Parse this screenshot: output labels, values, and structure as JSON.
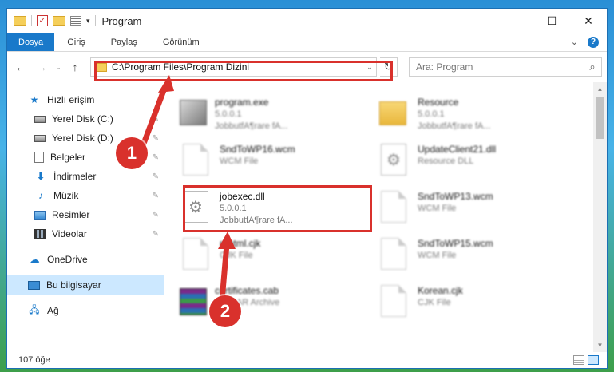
{
  "window": {
    "title": "Program",
    "controls": {
      "minimize": "—",
      "maximize": "☐",
      "close": "✕"
    }
  },
  "ribbon": {
    "tabs": [
      "Dosya",
      "Giriş",
      "Paylaş",
      "Görünüm"
    ],
    "expand": "⌄",
    "help": "?"
  },
  "nav": {
    "back": "←",
    "forward": "→",
    "recent": "⌄",
    "up": "↑",
    "address": "C:\\Program Files\\Program Dizini",
    "address_dropdown": "⌄",
    "refresh": "↻",
    "search_placeholder": "Ara: Program"
  },
  "sidebar": {
    "quick_access": "Hızlı erişim",
    "items": [
      {
        "label": "Yerel Disk (C:)",
        "icon": "disk-icon"
      },
      {
        "label": "Yerel Disk (D:)",
        "icon": "disk-icon"
      },
      {
        "label": "Belgeler",
        "icon": "document-icon"
      },
      {
        "label": "İndirmeler",
        "icon": "download-icon"
      },
      {
        "label": "Müzik",
        "icon": "music-icon"
      },
      {
        "label": "Resimler",
        "icon": "pictures-icon"
      },
      {
        "label": "Videolar",
        "icon": "videos-icon"
      }
    ],
    "onedrive": "OneDrive",
    "this_pc": "Bu bilgisayar",
    "network": "Ağ"
  },
  "files": [
    {
      "name": "program.exe",
      "line2": "5.0.0.1",
      "line3": "JobbutfA¶rare fA...",
      "icon": "exe"
    },
    {
      "name": "Resource",
      "line2": "5.0.0.1",
      "line3": "JobbutfA¶rare fA...",
      "icon": "folder"
    },
    {
      "name": "SndToWP16.wcm",
      "line2": "WCM File",
      "line3": "",
      "icon": "page"
    },
    {
      "name": "UpdateClient21.dll",
      "line2": "Resource DLL",
      "line3": "",
      "icon": "gear"
    },
    {
      "name": "jobexec.dll",
      "line2": "5.0.0.1",
      "line3": "JobbutfA¶rare fA...",
      "icon": "gear"
    },
    {
      "name": "SndToWP13.wcm",
      "line2": "WCM File",
      "line3": "",
      "icon": "page"
    },
    {
      "name": "rtfhtml.cjk",
      "line2": "CJK File",
      "line3": "",
      "icon": "page"
    },
    {
      "name": "SndToWP15.wcm",
      "line2": "WCM File",
      "line3": "",
      "icon": "page"
    },
    {
      "name": "certificates.cab",
      "line2": "WinRAR Archive",
      "line3": "",
      "icon": "cab"
    },
    {
      "name": "Korean.cjk",
      "line2": "CJK File",
      "line3": "",
      "icon": "page"
    }
  ],
  "status": {
    "count": "107 öğe"
  },
  "markers": {
    "one": "1",
    "two": "2"
  },
  "colors": {
    "accent": "#1979ca",
    "highlight": "#d9312c",
    "selection": "#cce8ff"
  }
}
